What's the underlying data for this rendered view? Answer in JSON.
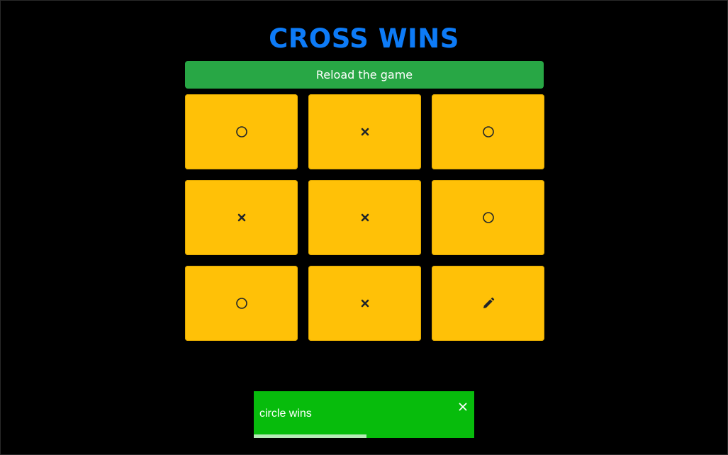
{
  "header": {
    "title": "CROSS WINS"
  },
  "controls": {
    "reload_label": "Reload the game"
  },
  "board": {
    "cells": [
      "circle",
      "cross",
      "circle",
      "cross",
      "cross",
      "circle",
      "circle",
      "cross",
      "pencil"
    ],
    "icon_names": {
      "circle": "circle-icon",
      "cross": "cross-icon",
      "pencil": "pencil-icon"
    }
  },
  "toast": {
    "message": "circle wins",
    "close_icon": "close-icon",
    "progress_fraction": 0.51
  },
  "colors": {
    "background": "#000000",
    "title": "#0d7bf7",
    "reload_button": "#28a745",
    "cell": "#ffc107",
    "mark": "#212529",
    "toast": "#07bc0c"
  }
}
